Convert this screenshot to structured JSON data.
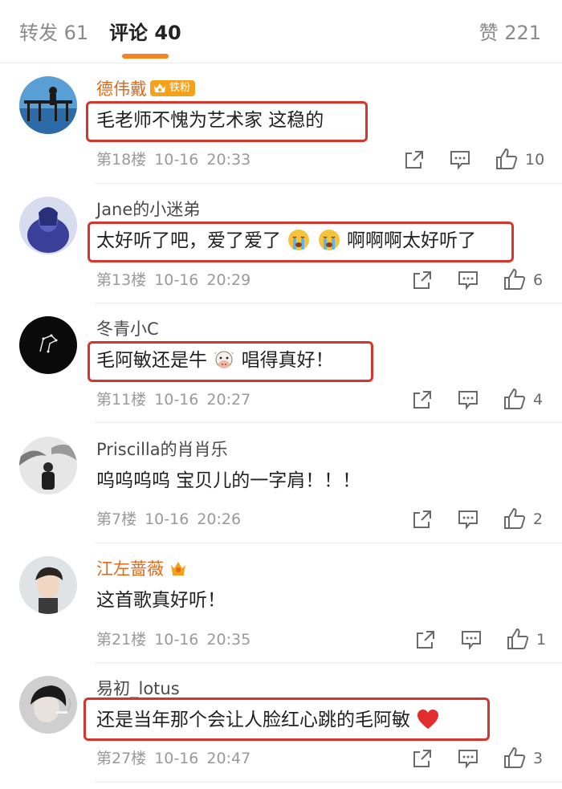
{
  "tabs": {
    "repost": "转发 61",
    "comment": "评论 40",
    "like": "赞 221"
  },
  "fan_tag": "铁粉",
  "comments": [
    {
      "username": "德伟戴",
      "text": "毛老师不愧为艺术家 这稳的",
      "floor": "第18楼",
      "date": "10-16",
      "time": "20:33",
      "likes": "10"
    },
    {
      "username": "Jane的小迷弟",
      "text_before": "太好听了吧，爱了爱了",
      "text_after": "啊啊啊太好听了",
      "floor": "第13楼",
      "date": "10-16",
      "time": "20:29",
      "likes": "6"
    },
    {
      "username": "冬青小C",
      "text_before": "毛阿敏还是牛",
      "text_after": "唱得真好！",
      "floor": "第11楼",
      "date": "10-16",
      "time": "20:27",
      "likes": "4"
    },
    {
      "username": "Priscilla的肖肖乐",
      "text": "呜呜呜呜 宝贝儿的一字肩！！！",
      "floor": "第7楼",
      "date": "10-16",
      "time": "20:26",
      "likes": "2"
    },
    {
      "username": "江左蔷薇",
      "text": "这首歌真好听！",
      "floor": "第21楼",
      "date": "10-16",
      "time": "20:35",
      "likes": "1"
    },
    {
      "username": "易初_lotus",
      "text": "还是当年那个会让人脸红心跳的毛阿敏",
      "floor": "第27楼",
      "date": "10-16",
      "time": "20:47",
      "likes": "3"
    }
  ],
  "icons": {
    "share": "share-icon",
    "reply": "reply-icon",
    "like": "thumbs-up-icon",
    "crying": "crying-emoji-icon",
    "cow": "cow-emoji-icon",
    "heart": "heart-emoji-icon",
    "crown": "crown-badge-icon"
  },
  "colors": {
    "accent": "#f5841f",
    "vip_name": "#e0691a",
    "highlight_box": "#d4352d"
  }
}
